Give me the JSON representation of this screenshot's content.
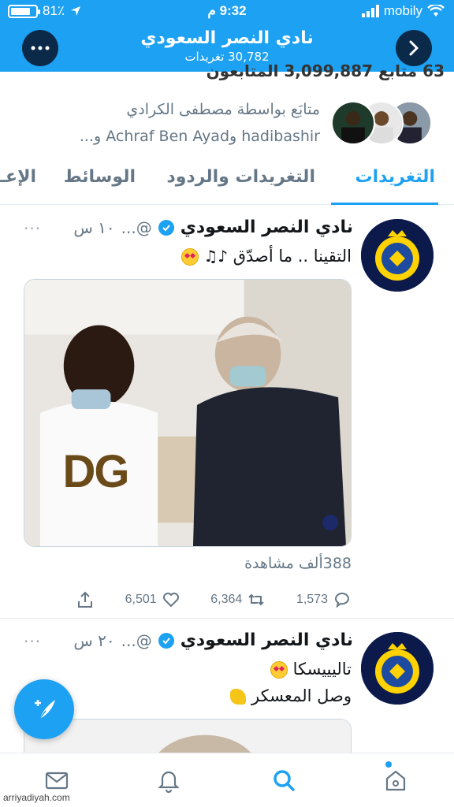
{
  "status_bar": {
    "battery": "81٪",
    "battery_level": 0.81,
    "time": "9:32 م",
    "carrier": "mobily"
  },
  "header": {
    "title": "نادي النصر السعودي",
    "subtitle": "30,782 تغريدات"
  },
  "profile": {
    "cutoff_stats": "63 متابع 3,099,887 المتابعون",
    "followed_by_line1": "متابَع بواسطة مصطفى الكرادي",
    "followed_by_line2": "hadibashir وAchraf Ben Ayad و..."
  },
  "tabs": [
    {
      "label": "التغريدات",
      "active": true
    },
    {
      "label": "التغريدات والردود",
      "active": false
    },
    {
      "label": "الوسائط",
      "active": false
    },
    {
      "label": "الإعـ",
      "active": false
    }
  ],
  "tweets": [
    {
      "name": "نادي النصر السعودي",
      "handle": "@...",
      "time": "١٠ س",
      "more": "···",
      "text": "التقينا .. ما أصدّق",
      "views": "388ألف مشاهدة",
      "replies": "1,573",
      "retweets": "6,364",
      "likes": "6,501",
      "media_text": "DG"
    },
    {
      "name": "نادي النصر السعودي",
      "handle": "@...",
      "time": "٢٠ س",
      "more": "···",
      "text_line1": "تاليييسكا",
      "text_line2": "وصل المعسكر"
    }
  ],
  "icons": {
    "fab": "compose-tweet-icon",
    "nav": [
      "mail-icon",
      "bell-icon",
      "search-icon",
      "home-icon"
    ]
  },
  "watermark": "arriyadiyah.com",
  "colors": {
    "accent": "#1da1f2",
    "header_button": "#0b2a4a",
    "muted": "#657786"
  }
}
